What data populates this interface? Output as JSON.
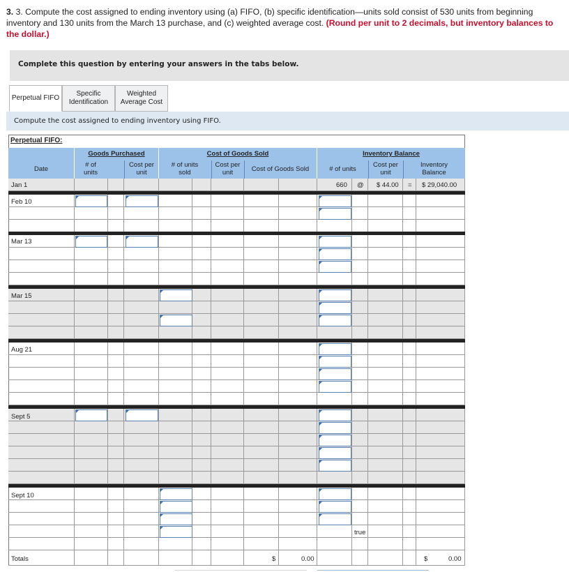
{
  "question": {
    "text": "3. Compute the cost assigned to ending inventory using (a) FIFO, (b) specific identification—units sold consist of 530 units from beginning inventory and 130 units from the March 13 purchase, and (c) weighted average cost.",
    "note": "(Round per unit to 2 decimals, but inventory balances to the dollar.)"
  },
  "banner": "Complete this question by entering your answers in the tabs below.",
  "tabs": {
    "fifo": "Perpetual FIFO",
    "specific_l1": "Specific",
    "specific_l2": "Identification",
    "weighted_l1": "Weighted",
    "weighted_l2": "Average Cost"
  },
  "instruction": "Compute the cost assigned to ending inventory using FIFO.",
  "table": {
    "title": "Perpetual FIFO:",
    "groups": {
      "purchased": "Goods Purchased",
      "cogs": "Cost of Goods Sold",
      "balance": "Inventory Balance"
    },
    "headers": {
      "date": "Date",
      "units_l1": "# of",
      "units_l2": "units",
      "cpu_l1": "Cost per",
      "cpu_l2": "unit",
      "sold_l1": "# of units",
      "sold_l2": "sold",
      "cogs": "Cost of Goods Sold",
      "bal_units": "# of units",
      "inv_l1": "Inventory",
      "inv_l2": "Balance"
    },
    "dates": {
      "jan1": "Jan 1",
      "feb10": "Feb 10",
      "mar13": "Mar 13",
      "mar15": "Mar 15",
      "aug21": "Aug 21",
      "sept5": "Sept 5",
      "sept10": "Sept 10",
      "totals": "Totals"
    },
    "jan1": {
      "units": "660",
      "at": "@",
      "cost": "$ 44.00",
      "eq": "=",
      "balance": "$ 29,040.00"
    },
    "stray": "true",
    "totals": {
      "cogs_symbol": "$",
      "cogs_value": "0.00",
      "bal_symbol": "$",
      "bal_value": "0.00"
    }
  }
}
